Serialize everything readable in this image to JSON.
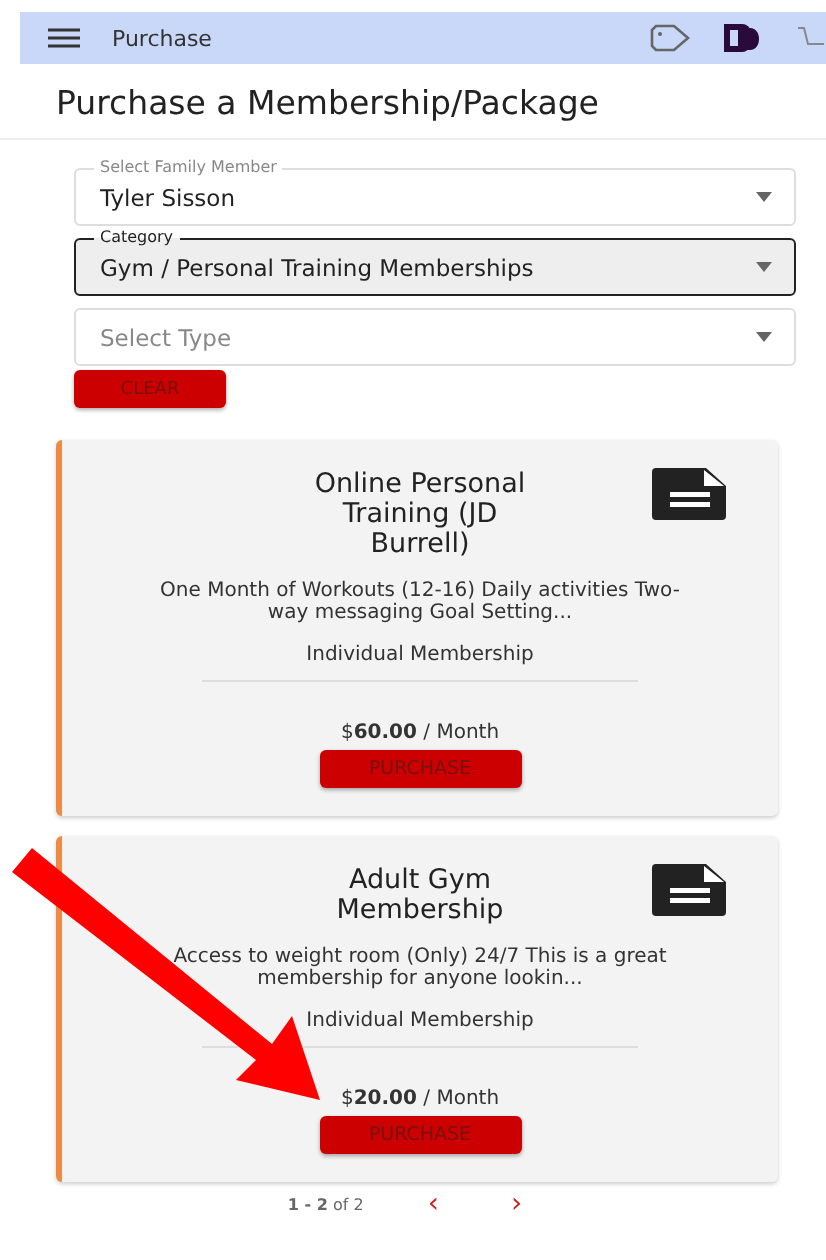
{
  "header": {
    "title": "Purchase"
  },
  "page_title": "Purchase a Membership/Package",
  "filters": [
    {
      "label": "Select Family Member",
      "value": "Tyler Sisson",
      "focused": false
    },
    {
      "label": "Category",
      "value": "Gym / Personal Training Memberships",
      "focused": true
    },
    {
      "placeholder": "Select Type",
      "focused": false
    }
  ],
  "clear_button": "CLEAR",
  "packages": [
    {
      "title": "Online Personal Training (JD Burrell)",
      "description": "One Month of Workouts (12-16) Daily activities Two-way messaging Goal Setting...",
      "type": "Individual Membership",
      "price": "$**60.00** / Month",
      "button": "PURCHASE"
    },
    {
      "title": "Adult Gym Membership",
      "description": "Access to weight room (Only) 24/7 This is a great membership for anyone lookin...",
      "type": "Individual Membership",
      "price": "$**20.00** / Month",
      "button": "PURCHASE"
    }
  ],
  "pagination": {
    "range": "1 - 2",
    "of": "of 2",
    "prev": "‹",
    "next": "›"
  }
}
